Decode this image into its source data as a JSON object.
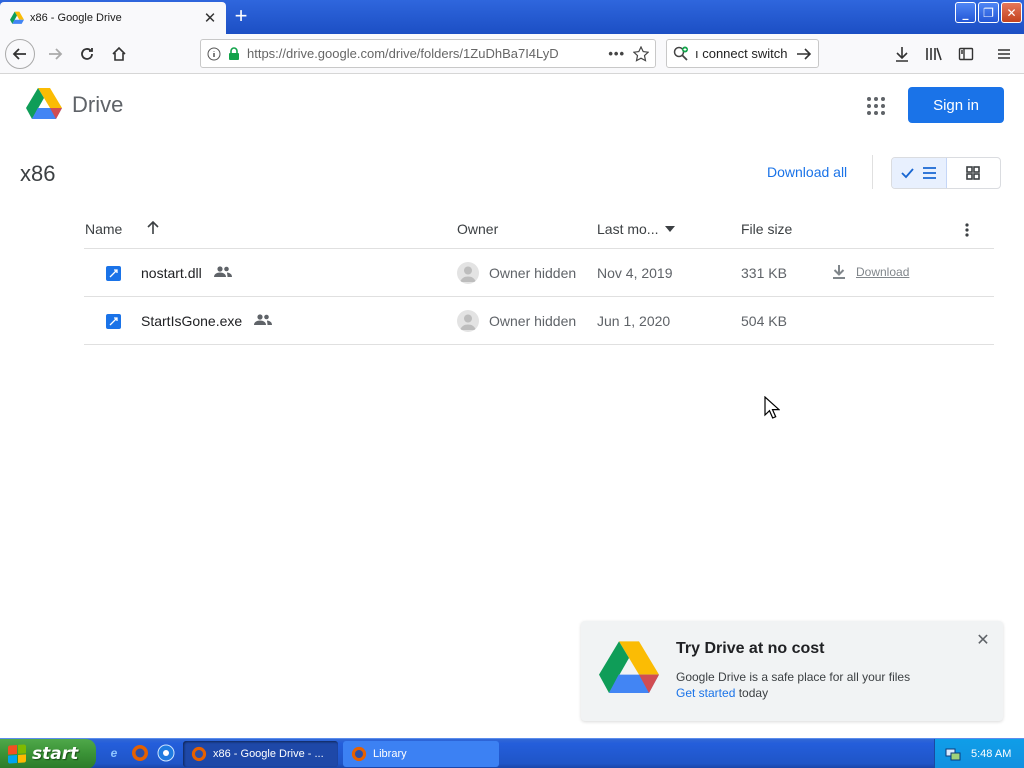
{
  "browser": {
    "tab_title": "x86 - Google Drive",
    "url": "https://drive.google.com/drive/folders/1ZuDhBa7I4LyD",
    "search_text": "ı connect switch"
  },
  "drive": {
    "brand": "Drive",
    "sign_in": "Sign in",
    "folder_title": "x86",
    "download_all": "Download all"
  },
  "table": {
    "headers": {
      "name": "Name",
      "owner": "Owner",
      "modified": "Last mo...",
      "size": "File size"
    },
    "rows": [
      {
        "name": "nostart.dll",
        "owner": "Owner hidden",
        "modified": "Nov 4, 2019",
        "size": "331 KB",
        "action": "Download"
      },
      {
        "name": "StartIsGone.exe",
        "owner": "Owner hidden",
        "modified": "Jun 1, 2020",
        "size": "504 KB",
        "action": ""
      }
    ]
  },
  "promo": {
    "title": "Try Drive at no cost",
    "body": "Google Drive is a safe place for all your files",
    "link": "Get started",
    "tail": "today"
  },
  "taskbar": {
    "start": "start",
    "tasks": [
      "x86 - Google Drive - ...",
      "Library"
    ],
    "clock": "5:48 AM"
  },
  "colors": {
    "accent": "#1a73e8",
    "xp_blue": "#245edb",
    "xp_start_green": "#3a9236"
  },
  "icons": [
    "google-drive-logo",
    "apps-grid-icon",
    "check-icon",
    "list-view-icon",
    "grid-view-icon",
    "sort-arrow-up-icon",
    "sort-caret-icon",
    "more-vert-icon",
    "shared-people-icon",
    "file-icon",
    "download-icon",
    "close-icon"
  ]
}
